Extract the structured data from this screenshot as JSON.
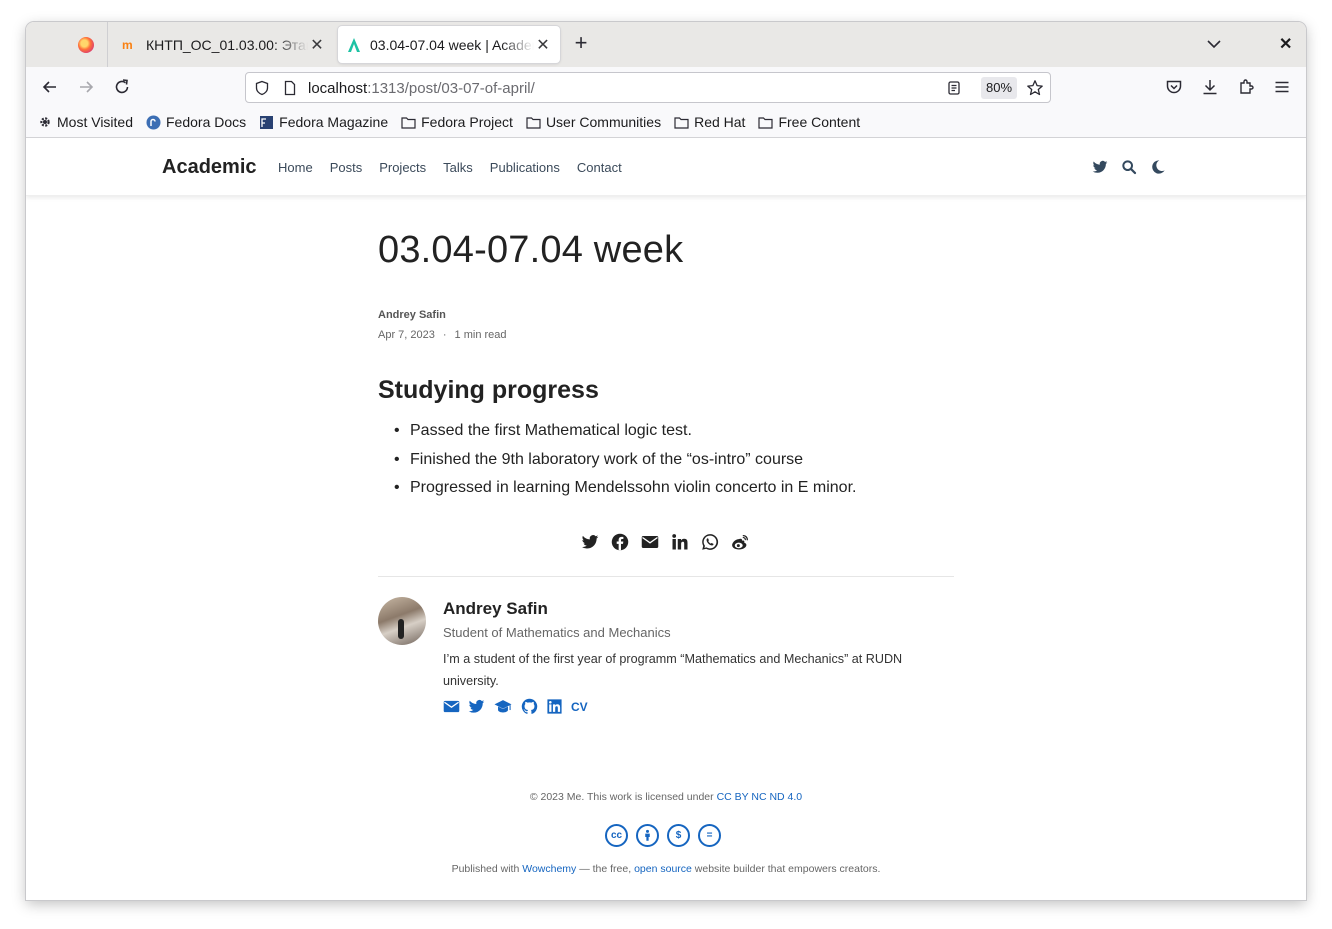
{
  "browser": {
    "tabs": [
      {
        "title": "КНТП_ОС_01.03.00: Этап"
      },
      {
        "title": "03.04-07.04 week | Academic"
      }
    ],
    "url_host": "localhost",
    "url_path": ":1313/post/03-07-of-april/",
    "zoom": "80%",
    "bookmarks": [
      "Most Visited",
      "Fedora Docs",
      "Fedora Magazine",
      "Fedora Project",
      "User Communities",
      "Red Hat",
      "Free Content"
    ]
  },
  "site": {
    "brand": "Academic",
    "menu": [
      "Home",
      "Posts",
      "Projects",
      "Talks",
      "Publications",
      "Contact"
    ]
  },
  "post": {
    "title": "03.04-07.04 week",
    "author": "Andrey Safin",
    "date": "Apr 7, 2023",
    "separator": "·",
    "read_time": "1 min read",
    "section_heading": "Studying progress",
    "bullets": [
      "Passed the first Mathematical logic test.",
      "Finished the 9th laboratory work of the “os-intro” course",
      "Progressed in learning Mendelssohn violin concerto in E minor."
    ]
  },
  "author_box": {
    "name": "Andrey Safin",
    "role": "Student of Mathematics and Mechanics",
    "bio": "I’m a student of the first year of programm “Mathematics and Mechanics” at RUDN university.",
    "cv_label": "CV"
  },
  "footer": {
    "copyright_prefix": "© 2023 Me. This work is licensed under ",
    "license_link": "CC BY NC ND 4.0",
    "published_prefix": "Published with ",
    "wowchemy": "Wowchemy",
    "middle": " — the free, ",
    "open_source": "open source",
    "suffix": " website builder that empowers creators."
  },
  "colors": {
    "link": "#1565c0",
    "text": "#222222"
  }
}
